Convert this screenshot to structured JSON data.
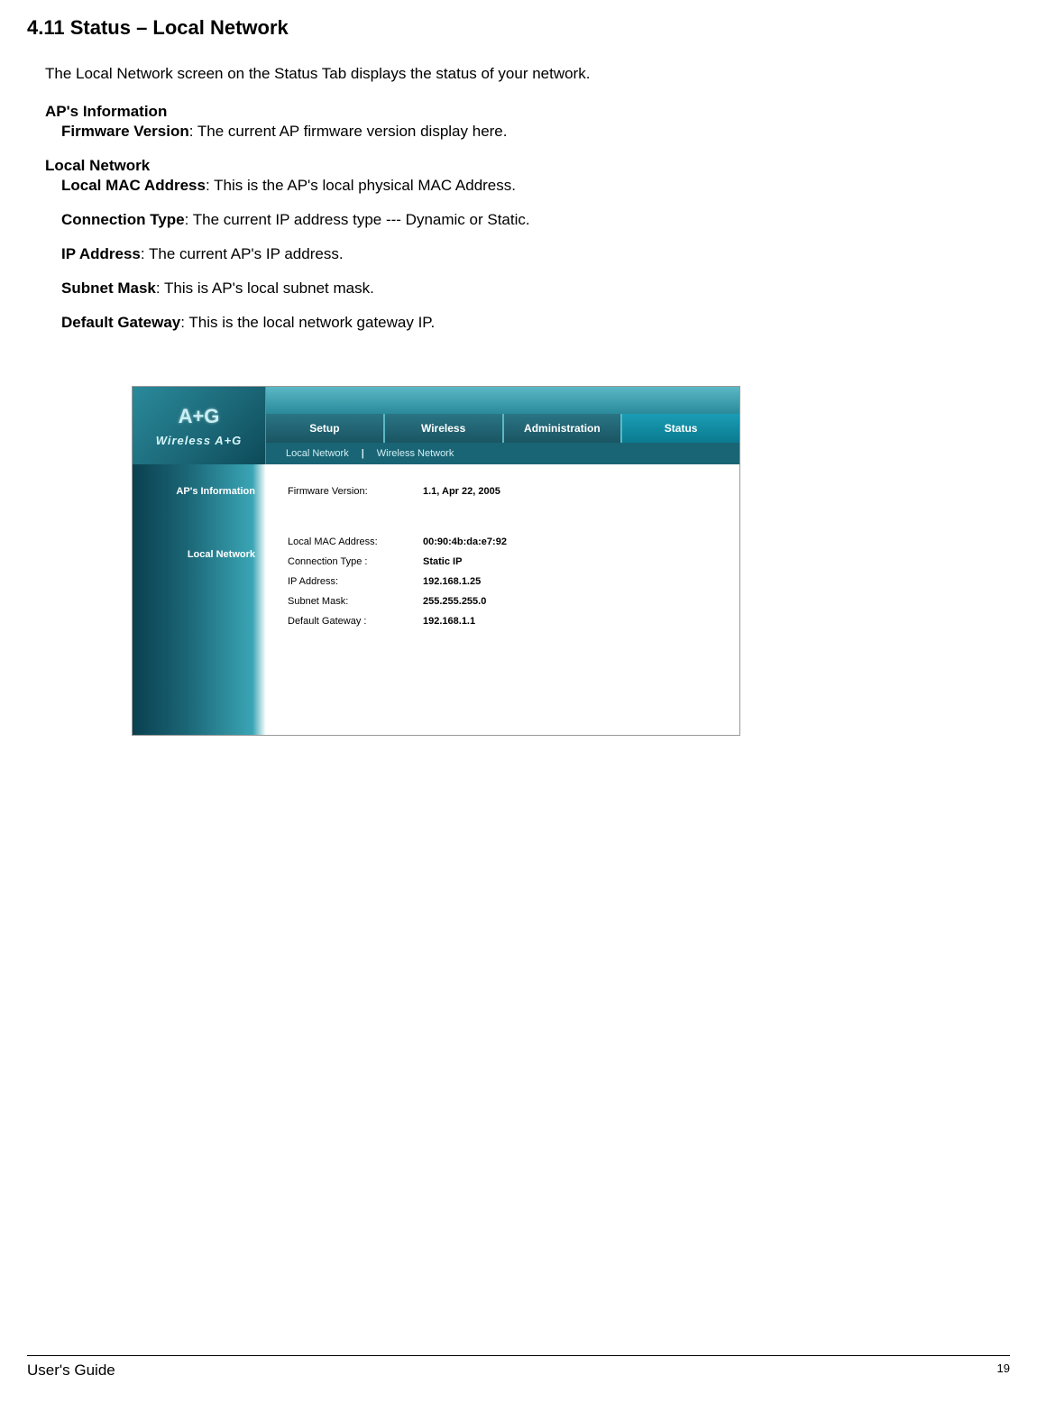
{
  "doc": {
    "section_title": "4.11 Status – Local Network",
    "intro": "The Local Network screen on the Status Tab displays the status of your network.",
    "group_ap": "AP's Information",
    "fields": {
      "firmware": {
        "label": "Firmware Version",
        "desc": ": The current AP firmware version display here."
      },
      "mac": {
        "label": "Local MAC Address",
        "desc": ": This is the AP's local physical MAC Address."
      },
      "conn": {
        "label": "Connection Type",
        "desc": ": The current IP address type --- Dynamic or Static."
      },
      "ip": {
        "label": "IP Address",
        "desc": ": The current AP's IP address."
      },
      "subnet": {
        "label": "Subnet Mask",
        "desc": ": This is AP's local subnet mask."
      },
      "gateway": {
        "label": "Default Gateway",
        "desc": ": This is the local network gateway IP."
      }
    },
    "group_local": "Local Network",
    "footer_left": "User's Guide",
    "footer_page": "19"
  },
  "router": {
    "brand": "Wireless A+G",
    "logo_badge": "A+G",
    "tabs": [
      "Setup",
      "Wireless",
      "Administration",
      "Status"
    ],
    "subtabs": [
      "Local Network",
      "Wireless Network"
    ],
    "sidebar": {
      "ap_info": "AP's Information",
      "local_net": "Local Network"
    },
    "rows": {
      "firmware": {
        "label": "Firmware Version:",
        "value": "1.1, Apr 22, 2005"
      },
      "mac": {
        "label": "Local MAC Address:",
        "value": "00:90:4b:da:e7:92"
      },
      "conn": {
        "label": "Connection Type :",
        "value": "Static IP"
      },
      "ip": {
        "label": "IP Address:",
        "value": "192.168.1.25"
      },
      "subnet": {
        "label": "Subnet Mask:",
        "value": "255.255.255.0"
      },
      "gateway": {
        "label": "Default Gateway :",
        "value": "192.168.1.1"
      }
    }
  }
}
